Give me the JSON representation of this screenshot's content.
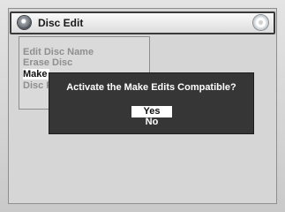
{
  "window": {
    "title": "Disc Edit",
    "title_icon": "remote-disc-icon",
    "disc_icon": "dvd-disc-icon"
  },
  "menu": {
    "items": [
      {
        "label": "Edit Disc Name"
      },
      {
        "label": "Erase Disc"
      },
      {
        "label": "Make"
      },
      {
        "label": "Disc F"
      }
    ],
    "selected_index": 2
  },
  "dialog": {
    "message": "Activate the Make Edits Compatible?",
    "options": [
      {
        "label": "Yes",
        "selected": true
      },
      {
        "label": "No",
        "selected": false
      }
    ]
  },
  "colors": {
    "dialog_bg": "#363636",
    "dim_text": "#8f8f8f",
    "highlight_bg": "#ffffff"
  }
}
